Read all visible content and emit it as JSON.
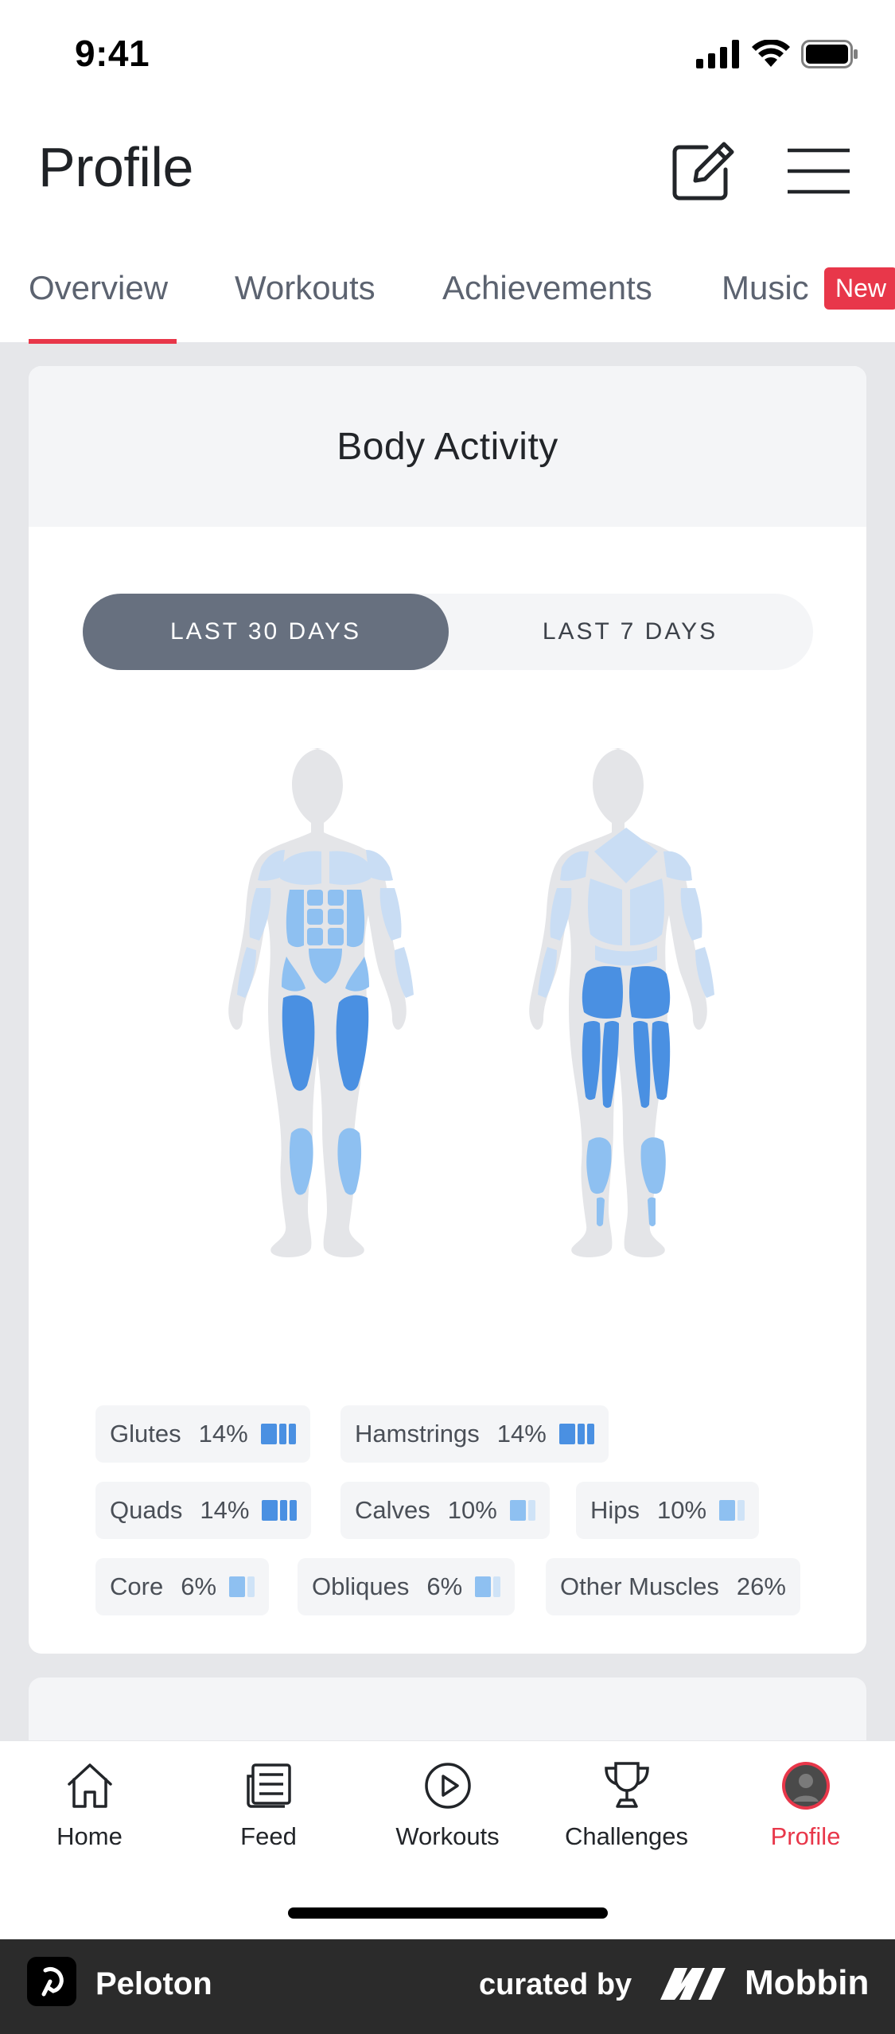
{
  "status": {
    "time": "9:41"
  },
  "header": {
    "title": "Profile",
    "edit_icon": "edit-icon",
    "menu_icon": "hamburger-icon"
  },
  "tabs": [
    {
      "label": "Overview",
      "active": true
    },
    {
      "label": "Workouts",
      "active": false
    },
    {
      "label": "Achievements",
      "active": false
    },
    {
      "label": "Music",
      "active": false,
      "badge": "New"
    }
  ],
  "body_activity": {
    "title": "Body Activity",
    "ranges": {
      "selected": "LAST 30 DAYS",
      "other": "LAST 7 DAYS"
    },
    "muscles": [
      {
        "name": "Glutes",
        "percent": "14%",
        "level": 3
      },
      {
        "name": "Hamstrings",
        "percent": "14%",
        "level": 3
      },
      {
        "name": "Quads",
        "percent": "14%",
        "level": 3
      },
      {
        "name": "Calves",
        "percent": "10%",
        "level": 2
      },
      {
        "name": "Hips",
        "percent": "10%",
        "level": 2
      },
      {
        "name": "Core",
        "percent": "6%",
        "level": 2
      },
      {
        "name": "Obliques",
        "percent": "6%",
        "level": 2
      },
      {
        "name": "Other Muscles",
        "percent": "26%",
        "level": 0
      }
    ]
  },
  "bottom_nav": [
    {
      "label": "Home",
      "icon": "home-icon",
      "active": false
    },
    {
      "label": "Feed",
      "icon": "feed-icon",
      "active": false
    },
    {
      "label": "Workouts",
      "icon": "play-circle-icon",
      "active": false
    },
    {
      "label": "Challenges",
      "icon": "trophy-icon",
      "active": false
    },
    {
      "label": "Profile",
      "icon": "avatar",
      "active": true
    }
  ],
  "footer": {
    "brand": "Peloton",
    "curated_by": "curated by",
    "curator": "Mobbin"
  },
  "colors": {
    "accent": "#e8374a",
    "muscle_high": "#4a90e2",
    "muscle_mid": "#8ec0f1",
    "muscle_low": "#cfe3f7",
    "segment_selected": "#67707f"
  }
}
